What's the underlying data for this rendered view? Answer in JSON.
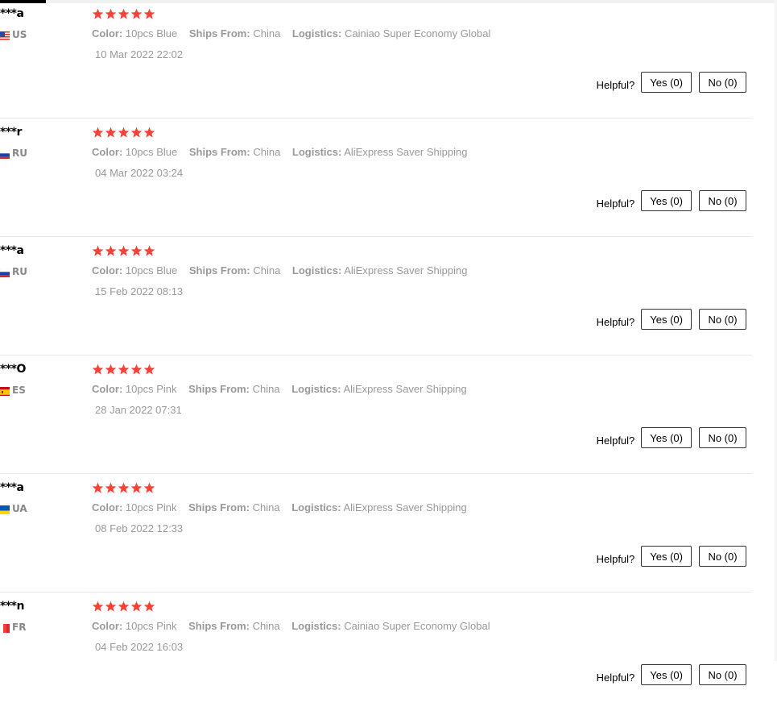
{
  "colors": {
    "star": "#f44336",
    "meta_text": "#999999",
    "divider": "#e8e8e8"
  },
  "labels": {
    "color": "Color:",
    "ships_from": "Ships From:",
    "logistics": "Logistics:",
    "helpful": "Helpful?"
  },
  "reviews": [
    {
      "name": "***a",
      "country": "US",
      "flag": "us-flag-icon",
      "rating": 5,
      "color_value": "10pcs Blue",
      "ships_from_value": "China",
      "logistics_value": "Cainiao Super Economy Global",
      "date": "10 Mar 2022 22:02",
      "yes": "Yes (0)",
      "no": "No (0)"
    },
    {
      "name": "***r",
      "country": "RU",
      "flag": "ru-flag-icon",
      "rating": 5,
      "color_value": "10pcs Blue",
      "ships_from_value": "China",
      "logistics_value": "AliExpress Saver Shipping",
      "date": "04 Mar 2022 03:24",
      "yes": "Yes (0)",
      "no": "No (0)"
    },
    {
      "name": "***a",
      "country": "RU",
      "flag": "ru-flag-icon",
      "rating": 5,
      "color_value": "10pcs Blue",
      "ships_from_value": "China",
      "logistics_value": "AliExpress Saver Shipping",
      "date": "15 Feb 2022 08:13",
      "yes": "Yes (0)",
      "no": "No (0)"
    },
    {
      "name": "***O",
      "country": "ES",
      "flag": "es-flag-icon",
      "rating": 5,
      "color_value": "10pcs Pink",
      "ships_from_value": "China",
      "logistics_value": "AliExpress Saver Shipping",
      "date": "28 Jan 2022 07:31",
      "yes": "Yes (0)",
      "no": "No (0)"
    },
    {
      "name": "***a",
      "country": "UA",
      "flag": "ua-flag-icon",
      "rating": 5,
      "color_value": "10pcs Pink",
      "ships_from_value": "China",
      "logistics_value": "AliExpress Saver Shipping",
      "date": "08 Feb 2022 12:33",
      "yes": "Yes (0)",
      "no": "No (0)"
    },
    {
      "name": "***n",
      "country": "FR",
      "flag": "fr-flag-icon",
      "rating": 5,
      "color_value": "10pcs Pink",
      "ships_from_value": "China",
      "logistics_value": "Cainiao Super Economy Global",
      "date": "04 Feb 2022 16:03",
      "yes": "Yes (0)",
      "no": "No (0)"
    }
  ]
}
